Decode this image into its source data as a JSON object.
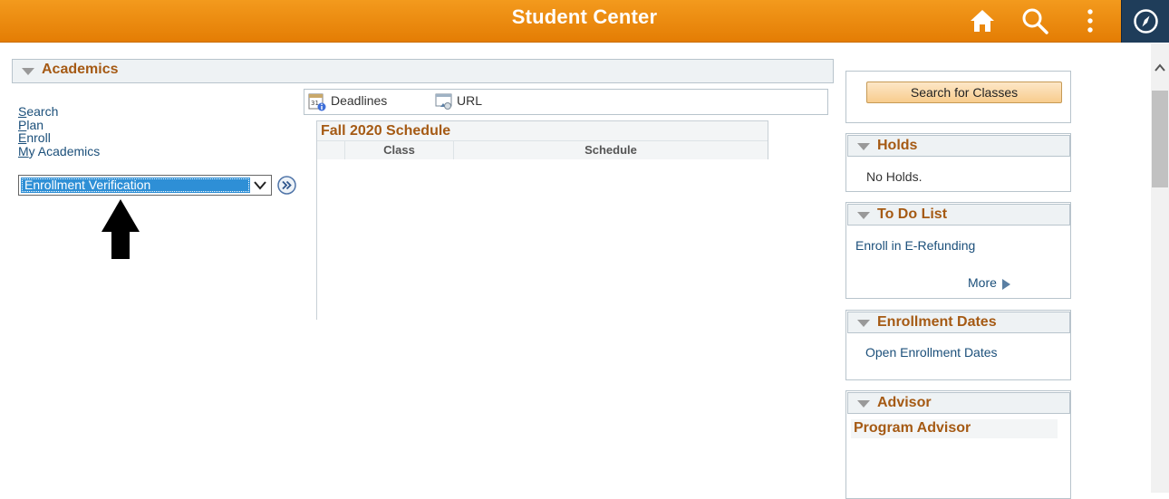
{
  "header": {
    "title": "Student Center"
  },
  "academics": {
    "title": "Academics",
    "links": [
      {
        "first": "S",
        "rest": "earch"
      },
      {
        "first": "P",
        "rest": "lan"
      },
      {
        "first": "E",
        "rest": "nroll"
      },
      {
        "first": "M",
        "rest": "y Academics"
      }
    ],
    "dropdown_value": "Enrollment Verification",
    "tabs": {
      "deadlines": "Deadlines",
      "url": "URL"
    },
    "schedule": {
      "title": "Fall 2020 Schedule",
      "columns": [
        "Class",
        "Schedule"
      ]
    }
  },
  "sidebar": {
    "search_classes_button": "Search for Classes",
    "holds": {
      "title": "Holds",
      "text": "No Holds."
    },
    "todo": {
      "title": "To Do List",
      "item": "Enroll in E-Refunding",
      "more": "More"
    },
    "enrollment_dates": {
      "title": "Enrollment Dates",
      "link": "Open Enrollment Dates"
    },
    "advisor": {
      "title": "Advisor",
      "subtitle": "Program Advisor"
    }
  },
  "colors": {
    "header": "#f0900f",
    "section_title": "#a55a14",
    "link": "#1b4f7a",
    "selection": "#2e8fd6",
    "nav_button": "#1f3d5a"
  },
  "icons": [
    "home-icon",
    "search-icon",
    "more-vert-icon",
    "navigator-compass-icon",
    "chevron-down-icon",
    "double-chevron-right-icon",
    "calendar-info-icon",
    "url-link-icon",
    "arrow-up-icon"
  ]
}
